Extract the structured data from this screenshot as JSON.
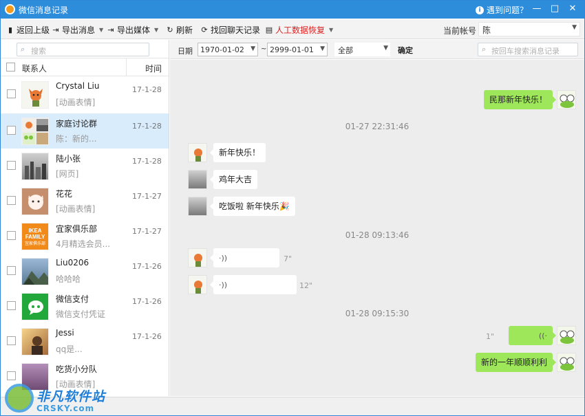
{
  "window": {
    "title": "微信消息记录",
    "help_label": "遇到问题？",
    "min_glyph": "—",
    "max_glyph": "□",
    "close_glyph": "✕"
  },
  "toolbar": {
    "back": "返回上级",
    "export_messages": "导出消息",
    "export_media": "导出媒体",
    "refresh": "刷新",
    "recover_history": "找回聊天记录",
    "manual_recovery": "人工数据恢复",
    "account_label": "当前帐号",
    "account_value": "陈"
  },
  "contacts": {
    "search_placeholder": "搜索",
    "col_contact": "联系人",
    "col_time": "时间",
    "items": [
      {
        "name": "Crystal Liu",
        "preview": "[动画表情]",
        "time": "17-1-28"
      },
      {
        "name": "家庭讨论群",
        "preview": "陈：新的...",
        "time": "17-1-28"
      },
      {
        "name": "陆小张",
        "preview": "[网页]",
        "time": "17-1-28"
      },
      {
        "name": "花花",
        "preview": "[动画表情]",
        "time": "17-1-27"
      },
      {
        "name": "宜家俱乐部",
        "preview": "4月精选会员...",
        "time": "17-1-27",
        "avatar_text": "IKEA FAMILY",
        "avatar_sub": "宜家俱乐部"
      },
      {
        "name": "Liu0206",
        "preview": "哈哈哈",
        "time": "17-1-26"
      },
      {
        "name": "微信支付",
        "preview": "微信支付凭证",
        "time": "17-1-26"
      },
      {
        "name": "Jessi",
        "preview": "qq是...",
        "time": "17-1-26"
      },
      {
        "name": "吃货小分队",
        "preview": "[动画表情]",
        "time": ""
      }
    ]
  },
  "filter": {
    "date_label": "日期",
    "date_from": "1970-01-02",
    "date_to": "2999-01-01",
    "tilde": "~",
    "scope": "全部",
    "confirm": "确定",
    "search_placeholder": "按回车搜索消息记录"
  },
  "chat": {
    "messages": [
      {
        "text": "民那新年快乐！"
      },
      {
        "stamp": "01-27 22:31:46"
      },
      {
        "text": "新年快乐！"
      },
      {
        "text": "鸡年大吉"
      },
      {
        "text": "吃饭啦 新年快乐🎉"
      },
      {
        "stamp": "01-28 09:13:46"
      },
      {
        "voice": "7\""
      },
      {
        "voice": "12\""
      },
      {
        "stamp": "01-28 09:15:30"
      },
      {
        "voice": "1\""
      },
      {
        "text": "新的一年顺顺利利"
      }
    ]
  },
  "watermark": {
    "title": "非凡软件站",
    "url": "CRSKY.com"
  },
  "colors": {
    "titlebar": "#2e8ddb",
    "selected_row": "#d9ecfb",
    "bubble_out": "#9ee65a",
    "chat_bg": "#ededed",
    "recovery_red": "#e02020"
  }
}
